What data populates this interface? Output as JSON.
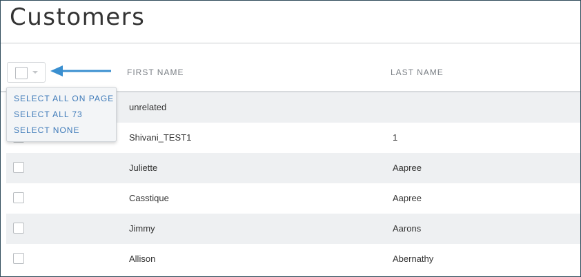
{
  "page": {
    "title": "Customers"
  },
  "table": {
    "headers": {
      "first_name": "FIRST NAME",
      "last_name": "LAST NAME"
    },
    "rows": [
      {
        "first": "unrelated",
        "last": ""
      },
      {
        "first": "Shivani_TEST1",
        "last": "1"
      },
      {
        "first": "Juliette",
        "last": "Aapree"
      },
      {
        "first": "Casstique",
        "last": "Aapree"
      },
      {
        "first": "Jimmy",
        "last": "Aarons"
      },
      {
        "first": "Allison",
        "last": "Abernathy"
      }
    ]
  },
  "select_menu": {
    "items": [
      "SELECT ALL ON PAGE",
      "SELECT ALL 73",
      "SELECT NONE"
    ]
  },
  "colors": {
    "menu_text": "#3d79b8",
    "arrow": "#3a8fd0",
    "row_shade": "#eef0f2"
  },
  "icons": {
    "pointer": "arrow-left-icon",
    "dropdown": "chevron-down-icon"
  }
}
